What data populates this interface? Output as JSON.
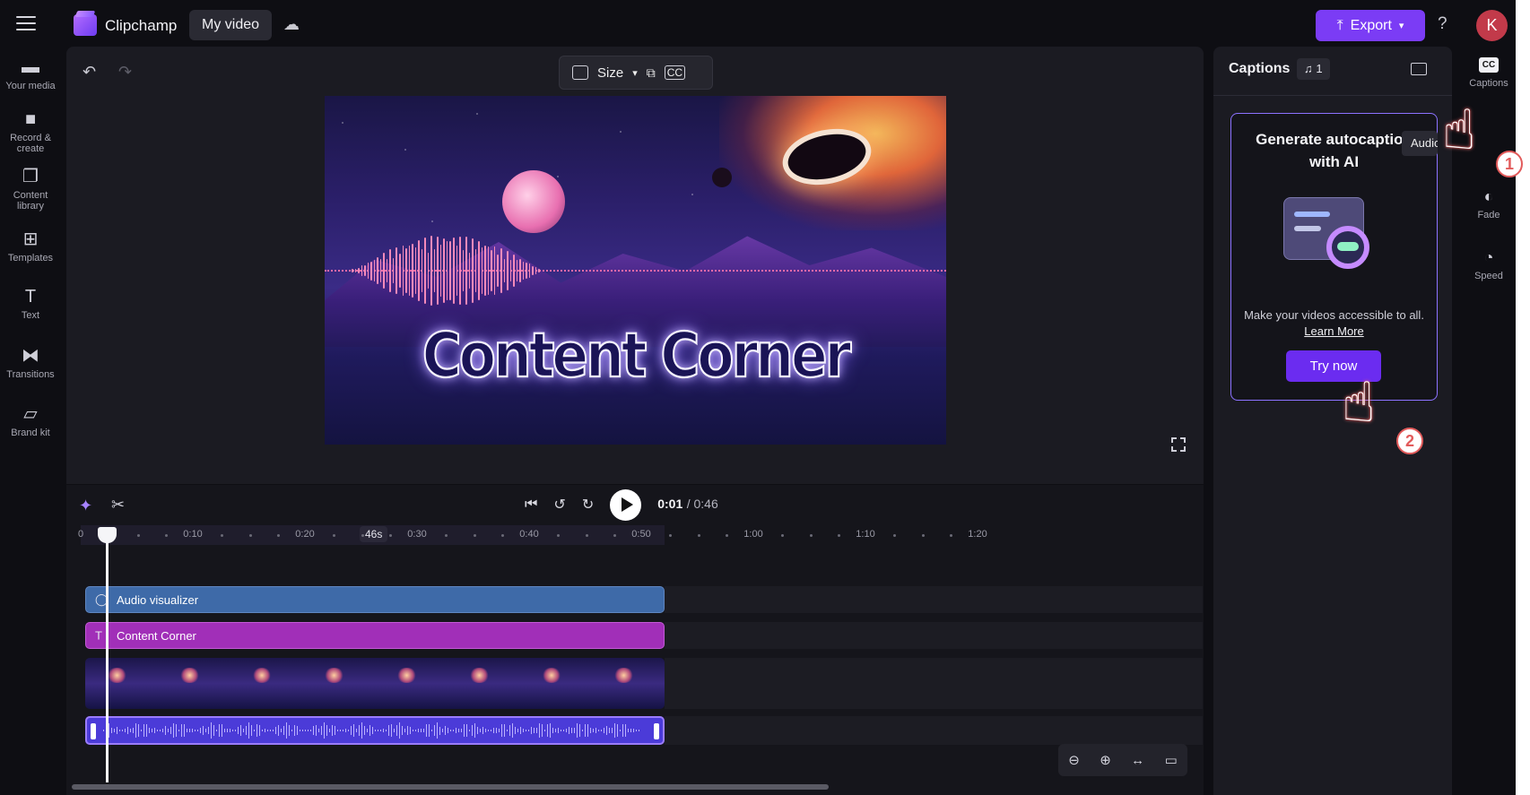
{
  "app": {
    "name": "Clipchamp",
    "video_tab": "My video"
  },
  "topbar": {
    "export_label": "Export",
    "help_label": "?",
    "avatar_initial": "K"
  },
  "sidebar": {
    "items": [
      {
        "label": "Your media",
        "icon": "folder-icon"
      },
      {
        "label": "Record & create",
        "icon": "camera-icon"
      },
      {
        "label": "Content library",
        "icon": "content-library-icon"
      },
      {
        "label": "Templates",
        "icon": "templates-icon"
      },
      {
        "label": "Text",
        "icon": "text-icon"
      },
      {
        "label": "Transitions",
        "icon": "transitions-icon"
      },
      {
        "label": "Brand kit",
        "icon": "brand-kit-icon"
      }
    ]
  },
  "preview": {
    "size_label": "Size",
    "video_title": "Content Corner"
  },
  "timeline": {
    "current_time": "0:01",
    "total_time": "/ 0:46",
    "ruler_ticks": [
      "0",
      "0:10",
      "0:20",
      "0:30",
      "0:40",
      "0:50",
      "1:00",
      "1:10",
      "1:20"
    ],
    "duration_marker": "46s",
    "tracks": {
      "audio_visualizer": "Audio visualizer",
      "text": "Content Corner"
    }
  },
  "captions": {
    "title": "Captions",
    "track_count": "1",
    "card_title_line1": "Generate autocaption",
    "card_title_line2": "with AI",
    "description": "Make your videos accessible to all.",
    "learn_more": "Learn More",
    "try_now": "Try now",
    "tooltip": "Audio"
  },
  "rail": {
    "items": [
      {
        "label": "Captions",
        "icon": "cc-icon"
      },
      {
        "label": "Fade",
        "icon": "fade-icon"
      },
      {
        "label": "Speed",
        "icon": "speed-icon"
      }
    ]
  },
  "annotations": {
    "step1": "1",
    "step2": "2"
  },
  "colors": {
    "accent": "#7b3cf5",
    "audio_track": "#3e6aa8",
    "text_track": "#a12fb8",
    "audio_clip": "#4b3bd8"
  }
}
